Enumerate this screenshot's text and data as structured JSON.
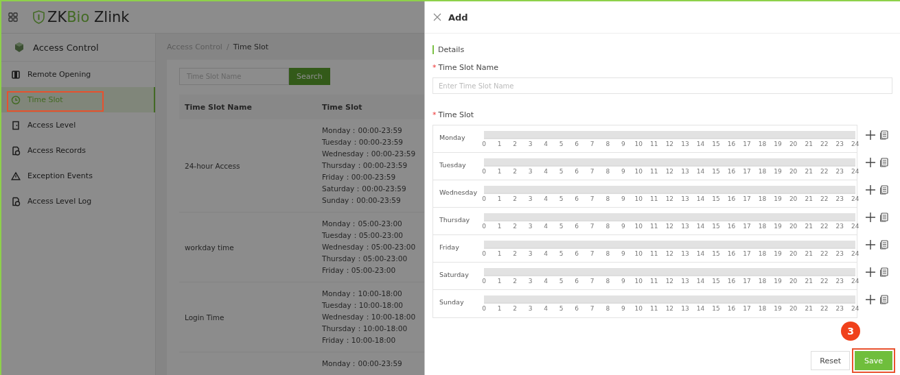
{
  "header": {
    "app_name_prefix": "ZKBio",
    "app_name_suffix": "Zlink"
  },
  "sidebar": {
    "module": "Access Control",
    "items": [
      {
        "label": "Remote Opening",
        "kind": "door",
        "selected": false
      },
      {
        "label": "Time Slot",
        "kind": "clock",
        "selected": true
      },
      {
        "label": "Access Level",
        "kind": "panel",
        "selected": false
      },
      {
        "label": "Access Records",
        "kind": "record",
        "selected": false
      },
      {
        "label": "Exception Events",
        "kind": "warning",
        "selected": false
      },
      {
        "label": "Access Level Log",
        "kind": "record",
        "selected": false
      }
    ]
  },
  "breadcrumb": {
    "items": [
      "Access Control",
      "Time Slot"
    ],
    "separator": "/"
  },
  "search": {
    "placeholder": "Time Slot Name",
    "button": "Search"
  },
  "table": {
    "columns": [
      "Time Slot Name",
      "Time Slot"
    ],
    "rows": [
      {
        "name": "24-hour Access",
        "slots": [
          "Monday：00:00-23:59",
          "Tuesday：00:00-23:59",
          "Wednesday：00:00-23:59",
          "Thursday：00:00-23:59",
          "Friday：00:00-23:59",
          "Saturday：00:00-23:59",
          "Sunday：00:00-23:59"
        ]
      },
      {
        "name": "workday time",
        "slots": [
          "Monday：05:00-23:00",
          "Tuesday：05:00-23:00",
          "Wednesday：05:00-23:00",
          "Thursday：05:00-23:00",
          "Friday：05:00-23:00"
        ]
      },
      {
        "name": "Login Time",
        "slots": [
          "Monday：10:00-18:00",
          "Tuesday：10:00-18:00",
          "Wednesday：10:00-18:00",
          "Thursday：10:00-18:00",
          "Friday：10:00-18:00"
        ]
      },
      {
        "name": "",
        "slots": [
          "Monday：00:00-23:59"
        ]
      }
    ]
  },
  "drawer": {
    "title": "Add",
    "section": "Details",
    "name_field": {
      "required_mark": "*",
      "label": "Time Slot Name",
      "placeholder": "Enter Time Slot Name"
    },
    "time_slot_required_mark": "*",
    "time_slot_label": "Time Slot",
    "days": [
      {
        "day": "Monday",
        "scale": [
          "0",
          "1",
          "2",
          "3",
          "4",
          "5",
          "6",
          "7",
          "8",
          "9",
          "10",
          "11",
          "12",
          "13",
          "14",
          "15",
          "16",
          "17",
          "18",
          "19",
          "20",
          "21",
          "22",
          "23",
          "24"
        ]
      },
      {
        "day": "Tuesday",
        "scale": [
          "0",
          "1",
          "2",
          "3",
          "4",
          "5",
          "6",
          "7",
          "8",
          "9",
          "10",
          "11",
          "12",
          "13",
          "14",
          "15",
          "16",
          "17",
          "18",
          "19",
          "20",
          "21",
          "22",
          "23",
          "24"
        ]
      },
      {
        "day": "Wednesday",
        "scale": [
          "0",
          "1",
          "2",
          "3",
          "4",
          "5",
          "6",
          "7",
          "8",
          "9",
          "10",
          "11",
          "12",
          "13",
          "14",
          "15",
          "16",
          "17",
          "18",
          "19",
          "20",
          "21",
          "22",
          "23",
          "24"
        ]
      },
      {
        "day": "Thursday",
        "scale": [
          "0",
          "1",
          "2",
          "3",
          "4",
          "5",
          "6",
          "7",
          "8",
          "9",
          "10",
          "11",
          "12",
          "13",
          "14",
          "15",
          "16",
          "17",
          "18",
          "19",
          "20",
          "21",
          "22",
          "23",
          "24"
        ]
      },
      {
        "day": "Friday",
        "scale": [
          "0",
          "1",
          "2",
          "3",
          "4",
          "5",
          "6",
          "7",
          "8",
          "9",
          "10",
          "11",
          "12",
          "13",
          "14",
          "15",
          "16",
          "17",
          "18",
          "19",
          "20",
          "21",
          "22",
          "23",
          "24"
        ]
      },
      {
        "day": "Saturday",
        "scale": [
          "0",
          "1",
          "2",
          "3",
          "4",
          "5",
          "6",
          "7",
          "8",
          "9",
          "10",
          "11",
          "12",
          "13",
          "14",
          "15",
          "16",
          "17",
          "18",
          "19",
          "20",
          "21",
          "22",
          "23",
          "24"
        ]
      },
      {
        "day": "Sunday",
        "scale": [
          "0",
          "1",
          "2",
          "3",
          "4",
          "5",
          "6",
          "7",
          "8",
          "9",
          "10",
          "11",
          "12",
          "13",
          "14",
          "15",
          "16",
          "17",
          "18",
          "19",
          "20",
          "21",
          "22",
          "23",
          "24"
        ]
      }
    ],
    "buttons": [
      "Reset",
      "Save"
    ]
  },
  "annotation": {
    "step": "3"
  }
}
